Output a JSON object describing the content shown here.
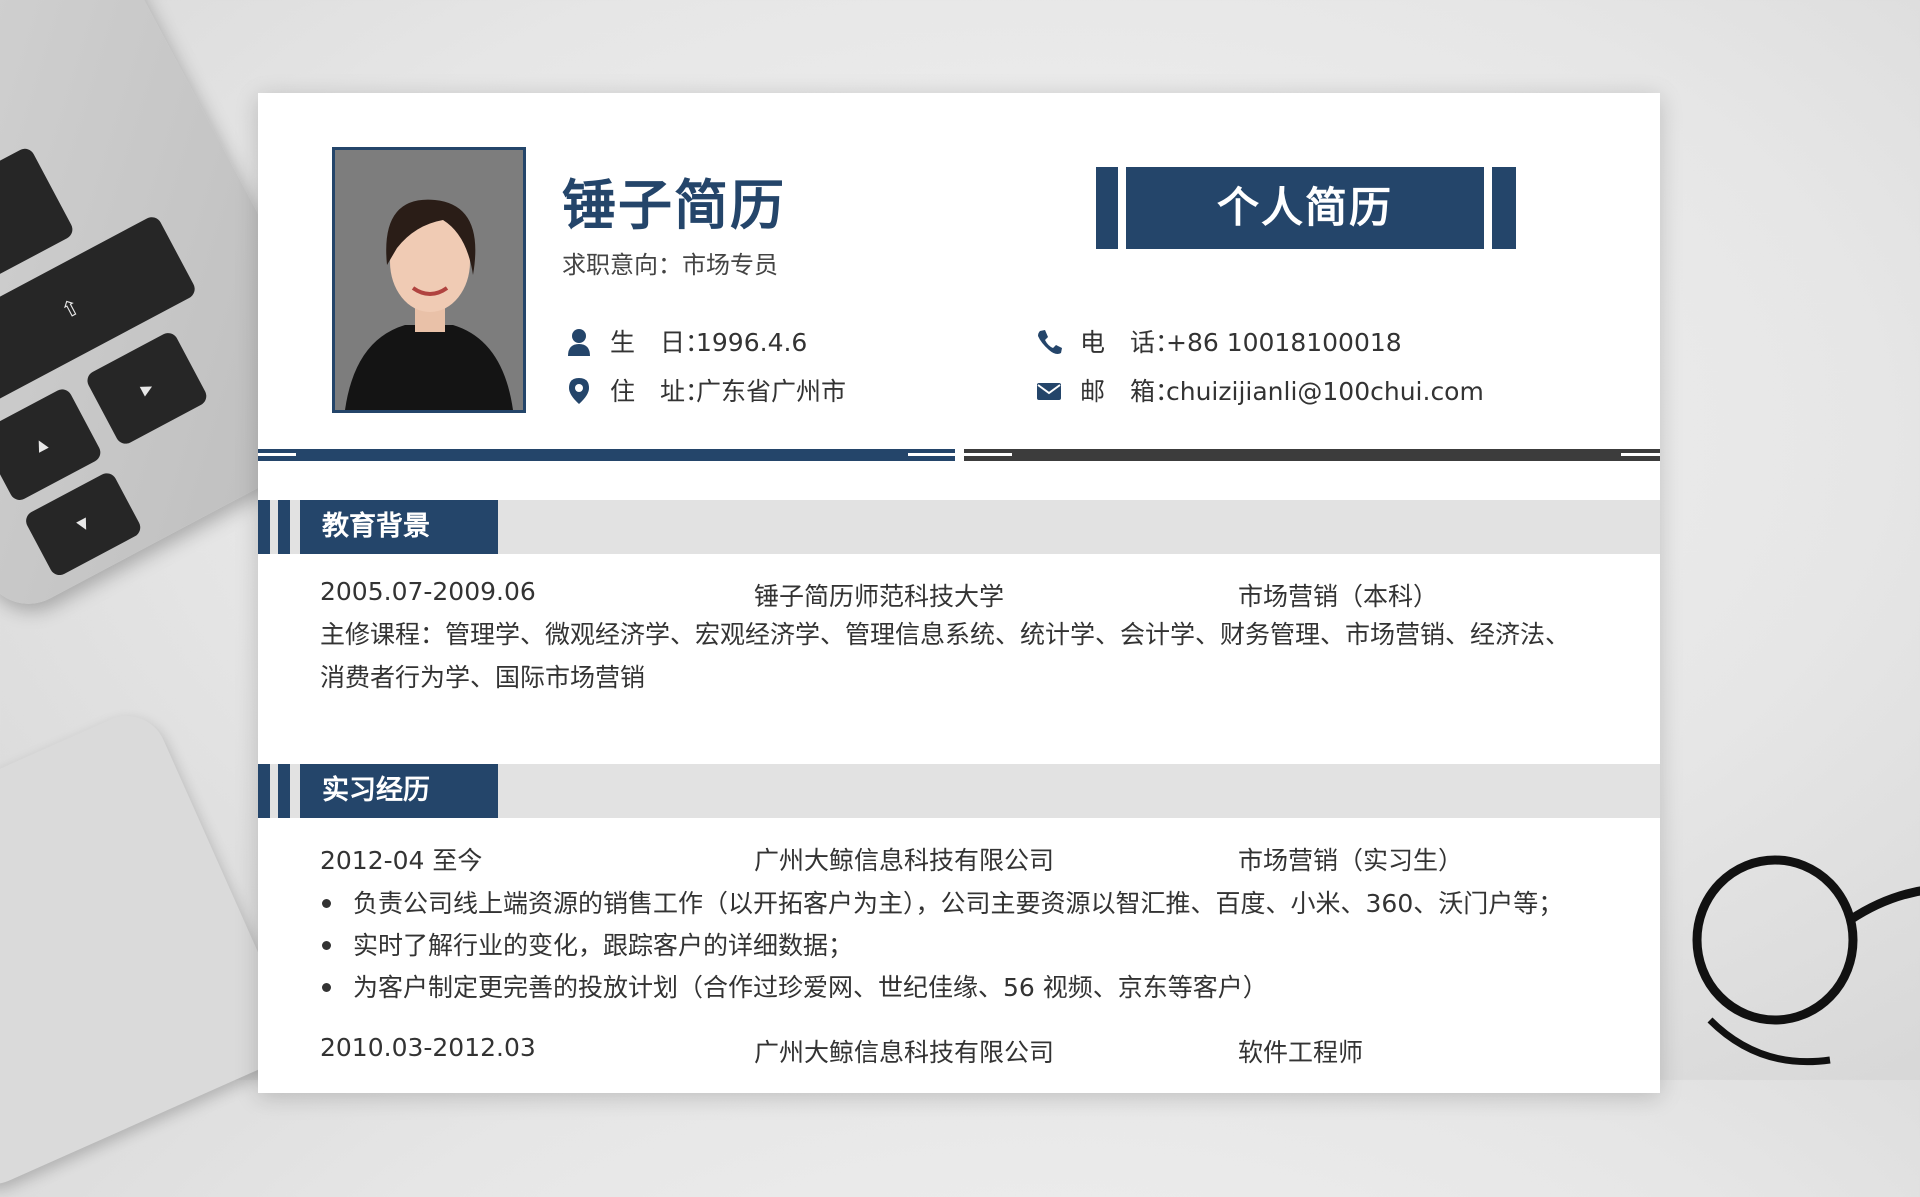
{
  "header": {
    "name": "锤子简历",
    "intent": "求职意向：市场专员",
    "banner": "个人简历"
  },
  "contact": {
    "birthday": {
      "icon": "person-icon",
      "label": "生　日：",
      "value": "1996.4.6"
    },
    "address": {
      "icon": "location-pin-icon",
      "label": "住　址：",
      "value": "广东省广州市"
    },
    "phone": {
      "icon": "phone-icon",
      "label": "电　话：",
      "value": "+86 10018100018"
    },
    "email": {
      "icon": "mail-icon",
      "label": "邮　箱：",
      "value": "chuizijianli@100chui.com"
    }
  },
  "colors": {
    "accent": "#24456a",
    "divider_dark": "#3c3c3c",
    "section_bg": "#e2e2e2"
  },
  "education": {
    "title": "教育背景",
    "period": "2005.07-2009.06",
    "school": "锤子简历师范科技大学",
    "major": "市场营销（本科）",
    "courses": "主修课程：管理学、微观经济学、宏观经济学、管理信息系统、统计学、会计学、财务管理、市场营销、经济法、消费者行为学、国际市场营销"
  },
  "internship": {
    "title": "实习经历",
    "jobs": [
      {
        "period": "2012-04 至今",
        "company": "广州大鲸信息科技有限公司",
        "role": "市场营销（实习生）",
        "duties": [
          "负责公司线上端资源的销售工作（以开拓客户为主），公司主要资源以智汇推、百度、小米、360、沃门户等；",
          "实时了解行业的变化，跟踪客户的详细数据；",
          "为客户制定更完善的投放计划（合作过珍爱网、世纪佳缘、56 视频、京东等客户）"
        ]
      },
      {
        "period": "2010.03-2012.03",
        "company": "广州大鲸信息科技有限公司",
        "role": "软件工程师"
      }
    ]
  }
}
